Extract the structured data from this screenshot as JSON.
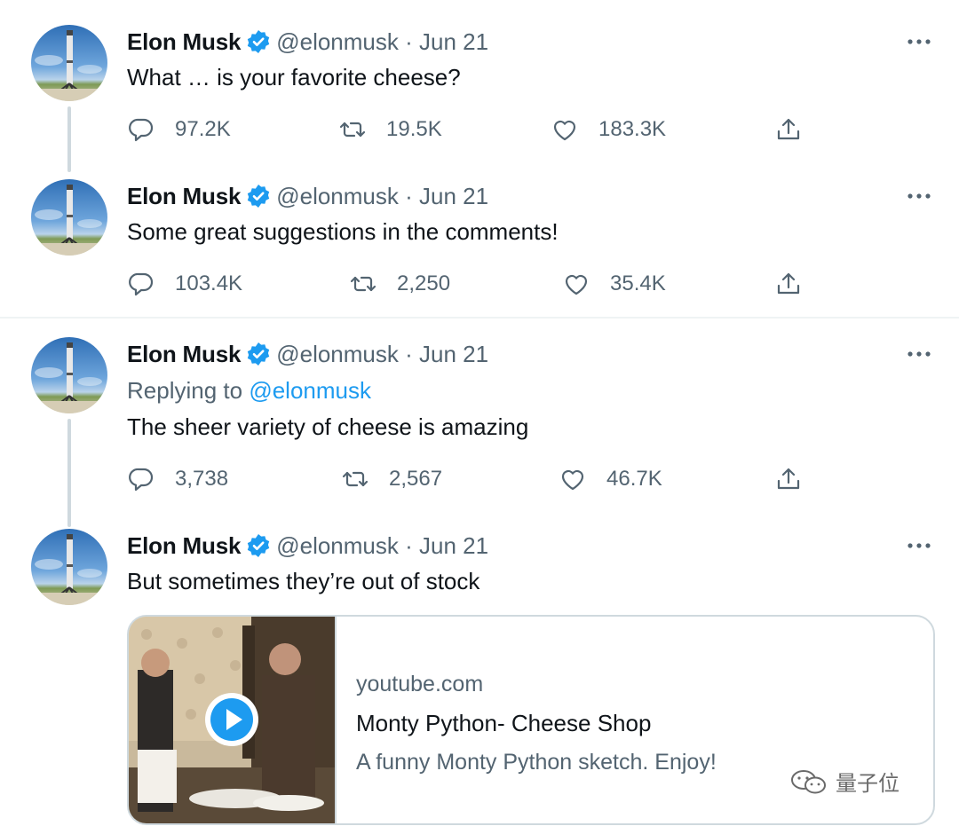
{
  "tweets": [
    {
      "name": "Elon Musk",
      "handle": "@elonmusk · Jun 21",
      "reply_label": "",
      "reply_mention": "",
      "text": "What … is your favorite cheese?",
      "replies": "97.2K",
      "retweets": "19.5K",
      "likes": "183.3K"
    },
    {
      "name": "Elon Musk",
      "handle": "@elonmusk · Jun 21",
      "text": "Some great suggestions in the comments!",
      "replies": "103.4K",
      "retweets": "2,250",
      "likes": "35.4K"
    },
    {
      "name": "Elon Musk",
      "handle": "@elonmusk · Jun 21",
      "reply_label": "Replying to ",
      "reply_mention": "@elonmusk",
      "text": "The sheer variety of cheese is amazing",
      "replies": "3,738",
      "retweets": "2,567",
      "likes": "46.7K"
    },
    {
      "name": "Elon Musk",
      "handle": "@elonmusk · Jun 21",
      "text": "But sometimes they’re out of stock",
      "card": {
        "domain": "youtube.com",
        "title": "Monty Python- Cheese Shop",
        "description": "A funny Monty Python sketch. Enjoy!"
      }
    }
  ],
  "icons": {
    "reply": "reply-icon",
    "retweet": "retweet-icon",
    "like": "heart-icon",
    "share": "share-icon",
    "verified": "verified-badge-icon",
    "more": "more-options-icon",
    "play": "play-icon"
  },
  "colors": {
    "accent": "#1d9bf0",
    "secondary_text": "#536471",
    "border": "#cfd9de"
  },
  "watermark": "量子位"
}
